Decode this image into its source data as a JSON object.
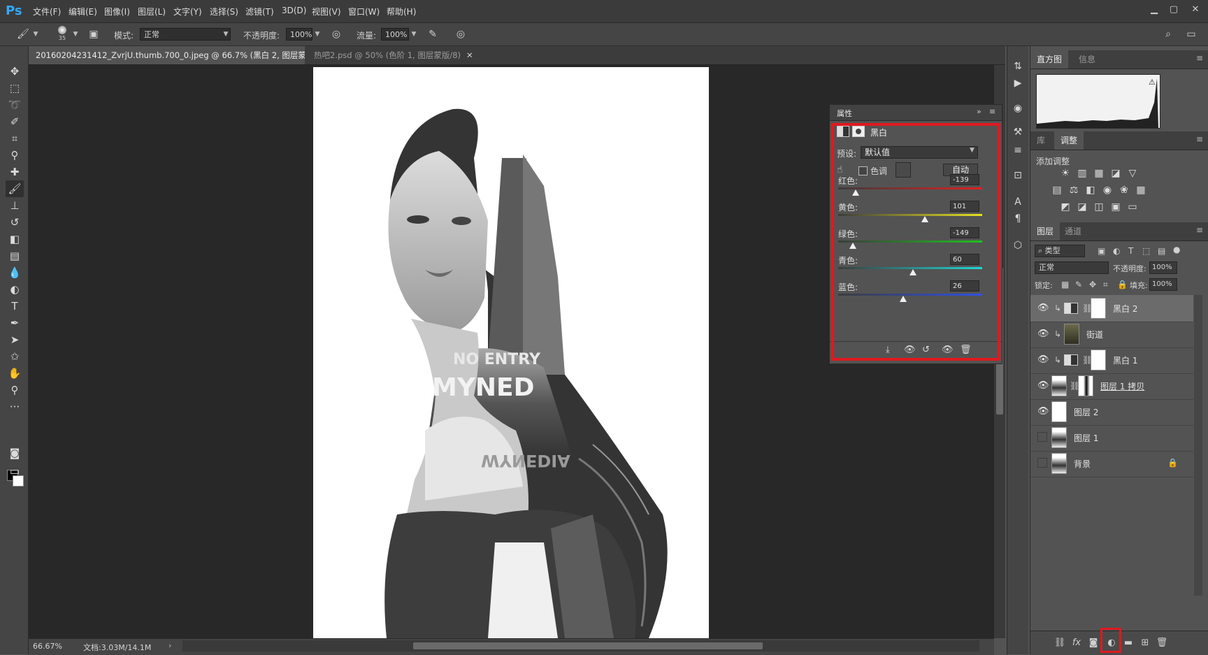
{
  "app": {
    "logo": "Ps"
  },
  "menu": [
    "文件(F)",
    "编辑(E)",
    "图像(I)",
    "图层(L)",
    "文字(Y)",
    "选择(S)",
    "滤镜(T)",
    "3D(D)",
    "视图(V)",
    "窗口(W)",
    "帮助(H)"
  ],
  "options": {
    "brush_size": "35",
    "mode_label": "模式:",
    "mode_value": "正常",
    "opacity_label": "不透明度:",
    "opacity_value": "100%",
    "flow_label": "流量:",
    "flow_value": "100%"
  },
  "tabs": [
    {
      "label": "20160204231412_ZvrjU.thumb.700_0.jpeg @ 66.7% (黑白 2, 图层蒙版/8) *",
      "active": true
    },
    {
      "label": "热吧2.psd @ 50% (色阶 1, 图层蒙版/8)",
      "active": false
    }
  ],
  "status": {
    "zoom": "66.67%",
    "doc": "文档:3.03M/14.1M"
  },
  "canvas_text": {
    "no_entry": "NO ENTRY",
    "myned": "MYNED",
    "mirror": "WYNEDIA"
  },
  "properties": {
    "title": "属性",
    "adjust_name": "黑白",
    "preset_label": "预设:",
    "preset_value": "默认值",
    "tint_label": "色调",
    "auto_label": "自动",
    "sliders": [
      {
        "label": "红色:",
        "value": "-139",
        "pos": -139
      },
      {
        "label": "黄色:",
        "value": "101",
        "pos": 101
      },
      {
        "label": "绿色:",
        "value": "-149",
        "pos": -149
      },
      {
        "label": "青色:",
        "value": "60",
        "pos": 60
      },
      {
        "label": "蓝色:",
        "value": "26",
        "pos": 26
      }
    ]
  },
  "histogram_panel": {
    "tab1": "直方图",
    "tab2": "信息"
  },
  "adjust_panel": {
    "tab1": "库",
    "tab2": "调整",
    "title": "添加调整"
  },
  "layers_panel": {
    "tab1": "图层",
    "tab2": "通道",
    "filter_label": "类型",
    "blend_mode": "正常",
    "opacity_label": "不透明度:",
    "opacity_value": "100%",
    "lock_label": "锁定:",
    "fill_label": "填充:",
    "fill_value": "100%",
    "layers": [
      {
        "name": "黑白 2",
        "visible": true,
        "selected": true
      },
      {
        "name": "街道",
        "visible": true,
        "selected": false
      },
      {
        "name": "黑白 1",
        "visible": true,
        "selected": false
      },
      {
        "name": "图层 1 拷贝",
        "visible": true,
        "selected": false
      },
      {
        "name": "图层 2",
        "visible": true,
        "selected": false
      },
      {
        "name": "图层 1",
        "visible": false,
        "selected": false
      },
      {
        "name": "背景",
        "visible": false,
        "selected": false
      }
    ]
  },
  "colors": {
    "accent_red": "#e0191f",
    "ps_blue": "#31a8ff"
  }
}
